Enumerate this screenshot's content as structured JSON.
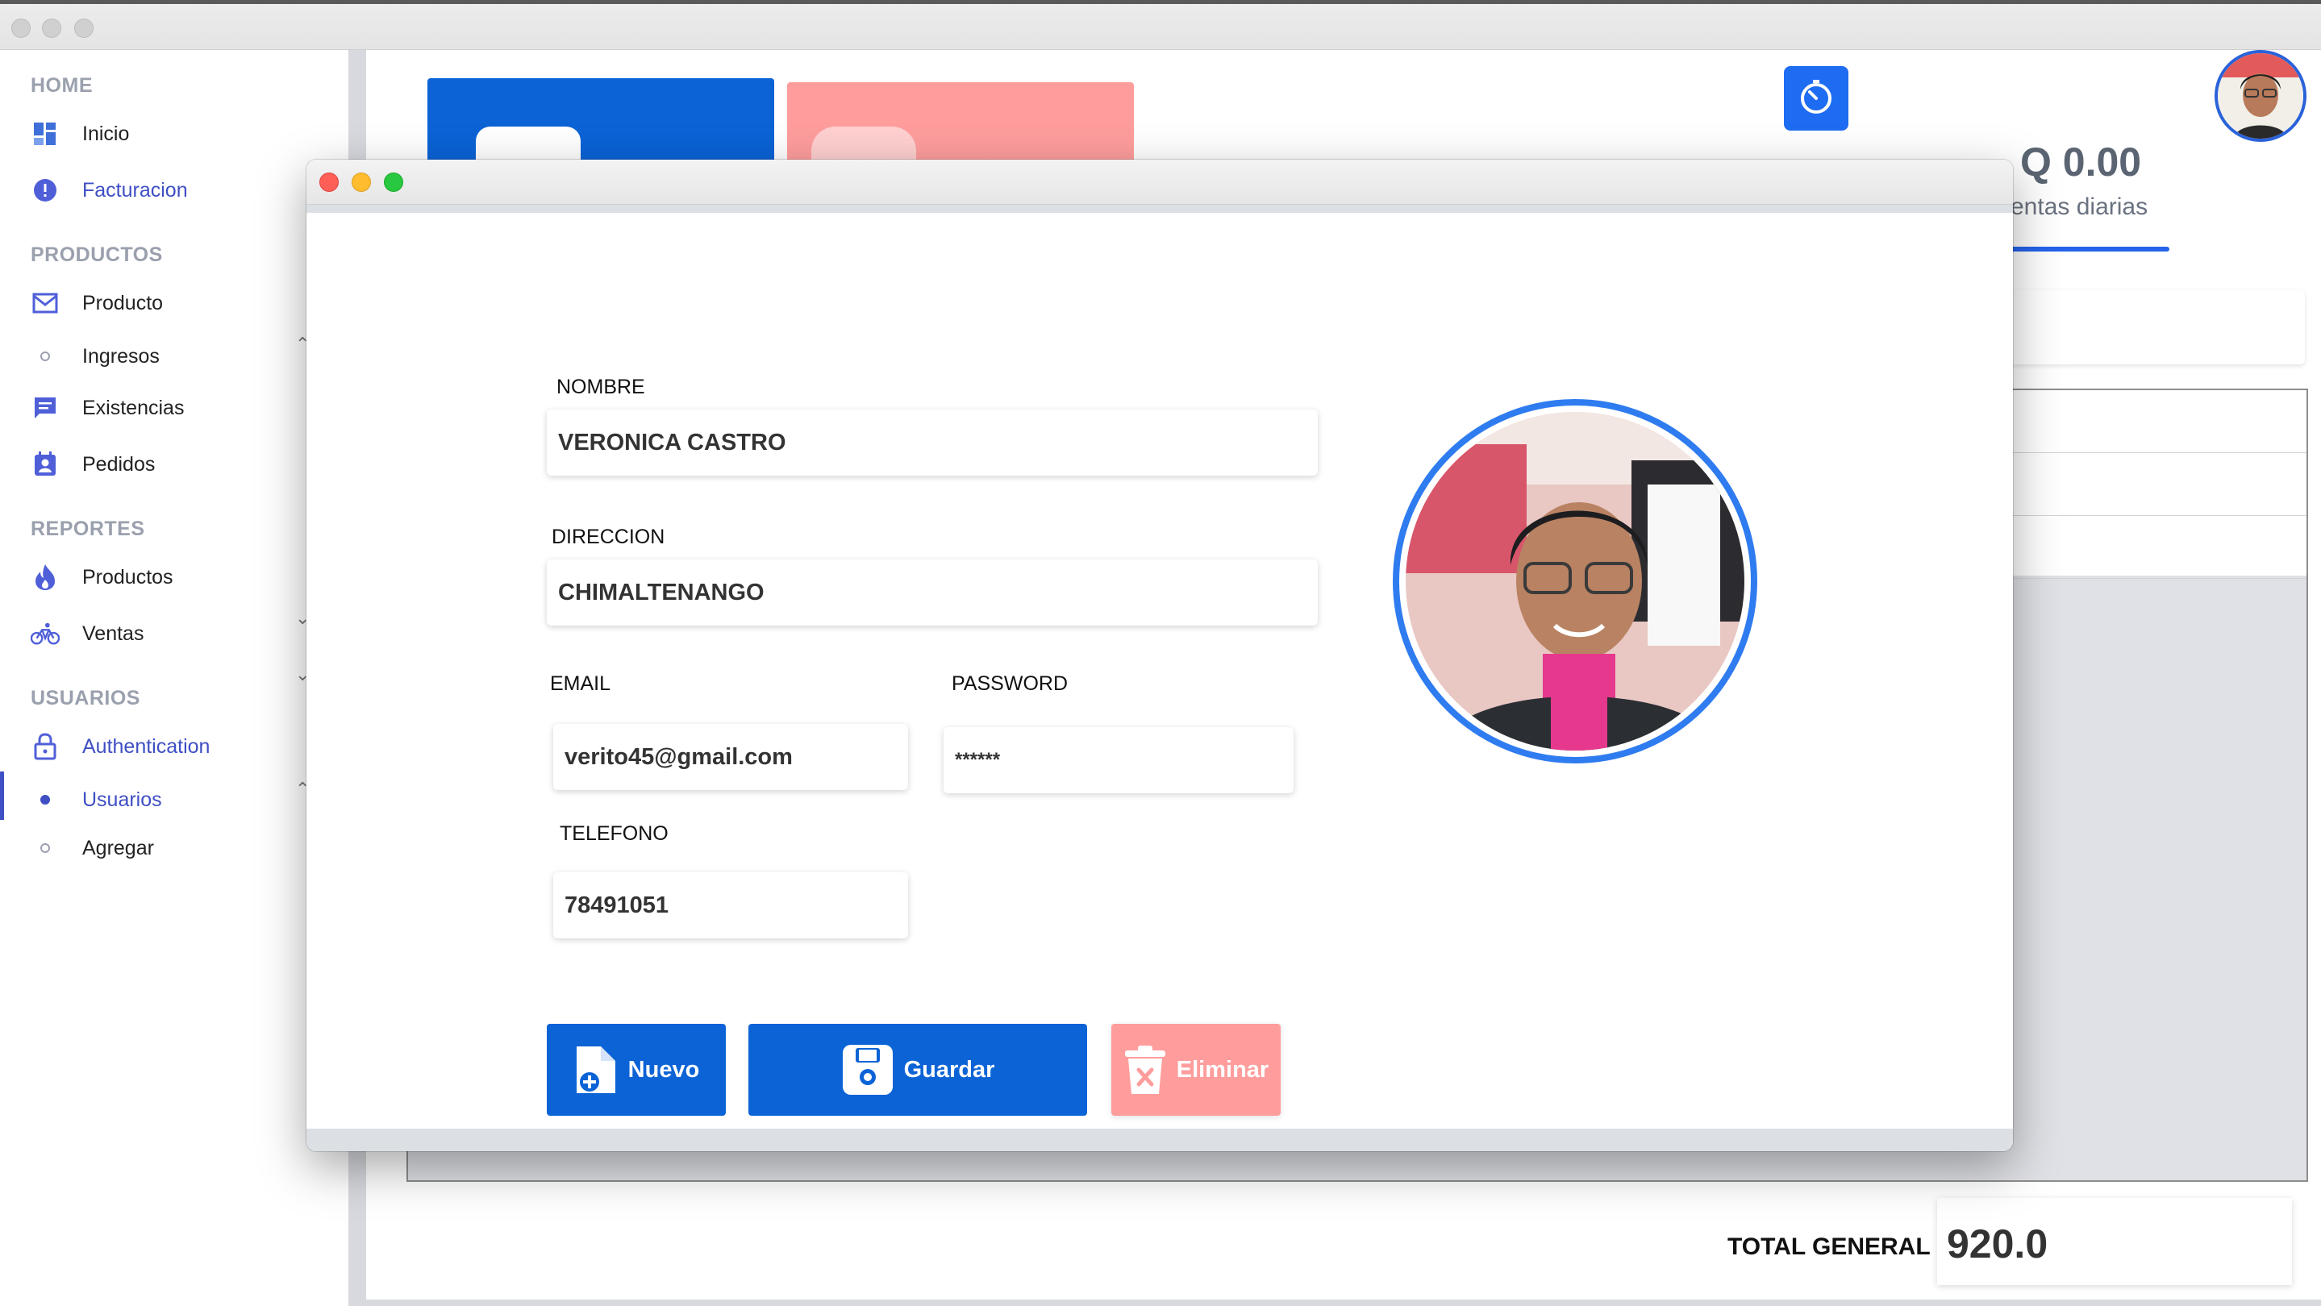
{
  "sidebar": {
    "sections": [
      {
        "title": "HOME",
        "items": [
          {
            "label": "Inicio",
            "icon": "dashboard-icon"
          },
          {
            "label": "Facturacion",
            "icon": "alert-icon"
          }
        ]
      },
      {
        "title": "PRODUCTOS",
        "items": [
          {
            "label": "Producto",
            "icon": "mail-icon"
          },
          {
            "label": "Ingresos",
            "icon": "circle-icon"
          },
          {
            "label": "Existencias",
            "icon": "message-icon"
          },
          {
            "label": "Pedidos",
            "icon": "contact-icon"
          }
        ]
      },
      {
        "title": "REPORTES",
        "items": [
          {
            "label": "Productos",
            "icon": "fire-icon"
          },
          {
            "label": "Ventas",
            "icon": "bike-icon"
          }
        ]
      },
      {
        "title": "USUARIOS",
        "items": [
          {
            "label": "Authentication",
            "icon": "lock-icon"
          },
          {
            "label": "Usuarios",
            "icon": "dot-icon"
          },
          {
            "label": "Agregar",
            "icon": "circle-icon"
          }
        ]
      }
    ],
    "active_item": "Usuarios"
  },
  "dashboard": {
    "daily_amount": "Q 0.00",
    "daily_label": "entas diarias",
    "total_label": "TOTAL GENERAL",
    "total_value": "920.0"
  },
  "form": {
    "nombre_label": "NOMBRE",
    "nombre_value": "VERONICA CASTRO",
    "direccion_label": "DIRECCION",
    "direccion_value": "CHIMALTENANGO",
    "email_label": "EMAIL",
    "email_value": "verito45@gmail.com",
    "password_label": "PASSWORD",
    "password_value": "******",
    "telefono_label": "TELEFONO",
    "telefono_value": "78491051"
  },
  "buttons": {
    "nuevo": "Nuevo",
    "guardar": "Guardar",
    "eliminar": "Eliminar"
  },
  "colors": {
    "primary": "#0b63d6",
    "danger": "#ff9d9d",
    "accent": "#3f4fc4",
    "ring": "#2f7cf0"
  }
}
